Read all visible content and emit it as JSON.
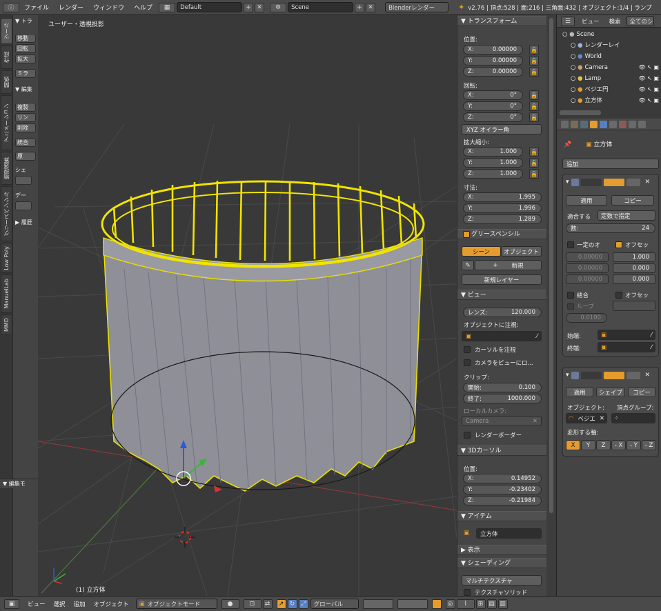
{
  "topbar": {
    "menus": [
      "ファイル",
      "レンダー",
      "ウィンドウ",
      "ヘルプ"
    ],
    "layout": "Default",
    "scene": "Scene",
    "engine": "Blenderレンダー",
    "stats": "v2.76 | 頂点:528 | 面:216 | 三角面:432 | オブジェクト:1/4 | ランプ"
  },
  "tool_tabs": [
    "ツール",
    "作成",
    "関係",
    "アニメーション",
    "物理演算",
    "グリースペンシル",
    "Low Poly",
    "ManuelLab",
    "MMD"
  ],
  "toolshelf": {
    "transform_header": "▼ トラ",
    "move": "移動",
    "rotate": "回転",
    "scale": "拡大",
    "mirror": "ミラ",
    "edit_header": "▼ 編集",
    "duplicate": "複製",
    "link": "リン",
    "delete": "削除",
    "join": "統合",
    "origin": "原",
    "shade": "シェ",
    "data": "デー",
    "history_header": "▶ 履歴",
    "operator_header": "▼ 編集モ"
  },
  "viewport": {
    "label": "ユーザー・透視投影",
    "object_label": "(1) 立方体"
  },
  "npanel": {
    "transform_header": "▼ トランスフォーム",
    "location_label": "位置:",
    "location": {
      "x": "0.00000",
      "y": "0.00000",
      "z": "0.00000"
    },
    "rotation_label": "回転:",
    "rotation": {
      "x": "0°",
      "y": "0°",
      "z": "0°"
    },
    "rotation_mode": "XYZ オイラー角",
    "scale_label": "拡大縮小:",
    "scale": {
      "x": "1.000",
      "y": "1.000",
      "z": "1.000"
    },
    "dimensions_label": "寸法:",
    "dimensions": {
      "x": "1.995",
      "y": "1.996",
      "z": "1.289"
    },
    "axis_x": "X:",
    "axis_y": "Y:",
    "axis_z": "Z:",
    "grease_header": "グリースペンシル",
    "grease_scene": "シーン",
    "grease_object": "オブジェクト",
    "grease_new": "新規",
    "grease_new_layer": "新規レイヤー",
    "view_header": "▼ ビュー",
    "lens_label": "レンズ:",
    "lens_value": "120.000",
    "lock_object_label": "オブジェクトに注視:",
    "lock_cursor": "カーソルを注視",
    "lock_camera": "カメラをビューにロ...",
    "clip_label": "クリップ:",
    "clip_start_label": "開始:",
    "clip_start": "0.100",
    "clip_end_label": "終了:",
    "clip_end": "1000.000",
    "local_camera_label": "ローカルカメラ:",
    "local_camera": "Camera",
    "render_border": "レンダーボーダー",
    "cursor_header": "▼ 3Dカーソル",
    "cursor_location_label": "位置:",
    "cursor": {
      "x": "0.14952",
      "y": "-0.23402",
      "z": "-0.21984"
    },
    "item_header": "▼ アイテム",
    "item_name": "立方体",
    "display_header": "▶ 表示",
    "shading_header": "▼ シェーディング",
    "shading_mode": "マルチテクスチャ",
    "texture_solid": "テクスチャソリッド"
  },
  "outliner": {
    "view": "ビュー",
    "search": "検索",
    "all": "全てのシ",
    "rows": [
      {
        "label": "Scene",
        "icon": "scene-icon",
        "indent": 0
      },
      {
        "label": "レンダーレイ",
        "icon": "renderlayer-icon",
        "indent": 1
      },
      {
        "label": "World",
        "icon": "world-icon",
        "indent": 1
      },
      {
        "label": "Camera",
        "icon": "camera-icon",
        "indent": 1
      },
      {
        "label": "Lamp",
        "icon": "lamp-icon",
        "indent": 1
      },
      {
        "label": "ベジエ円",
        "icon": "curve-icon",
        "indent": 1
      },
      {
        "label": "立方体",
        "icon": "mesh-icon",
        "indent": 1
      }
    ]
  },
  "props": {
    "object_name": "立方体",
    "add_modifier": "追加",
    "array": {
      "apply": "適用",
      "copy": "コピー",
      "fit_label": "適合する",
      "fit_mode": "定数で指定",
      "count_label": "数:",
      "count": "24",
      "constant": "一定のオ",
      "relative": "オフセッ",
      "const_vals": [
        "0.00000",
        "0.00000",
        "0.00000"
      ],
      "rel_vals": [
        "1.000",
        "0.000",
        "0.000"
      ],
      "merge": "結合",
      "offset_obj": "オフセッ",
      "loop": "ループ",
      "merge_dist": "0.0100",
      "start_label": "始端:",
      "end_label": "終端:"
    },
    "curve": {
      "apply": "適用",
      "shape": "シェイプ",
      "copy": "コピー",
      "object_label": "オブジェクト:",
      "vgroup_label": "頂点グループ:",
      "object_value": "ベジエ",
      "deform_label": "変形する軸:",
      "axes": [
        "X",
        "Y",
        "Z",
        "- X",
        "- Y",
        "- Z"
      ]
    }
  },
  "bottombar": {
    "view": "ビュー",
    "select": "選択",
    "add": "追加",
    "object": "オブジェクト",
    "mode": "オブジェクトモード",
    "orientation": "グローバル"
  },
  "colors": {
    "accent": "#e49c2e",
    "selection": "#f5e300",
    "active_blue": "#5680c2"
  }
}
